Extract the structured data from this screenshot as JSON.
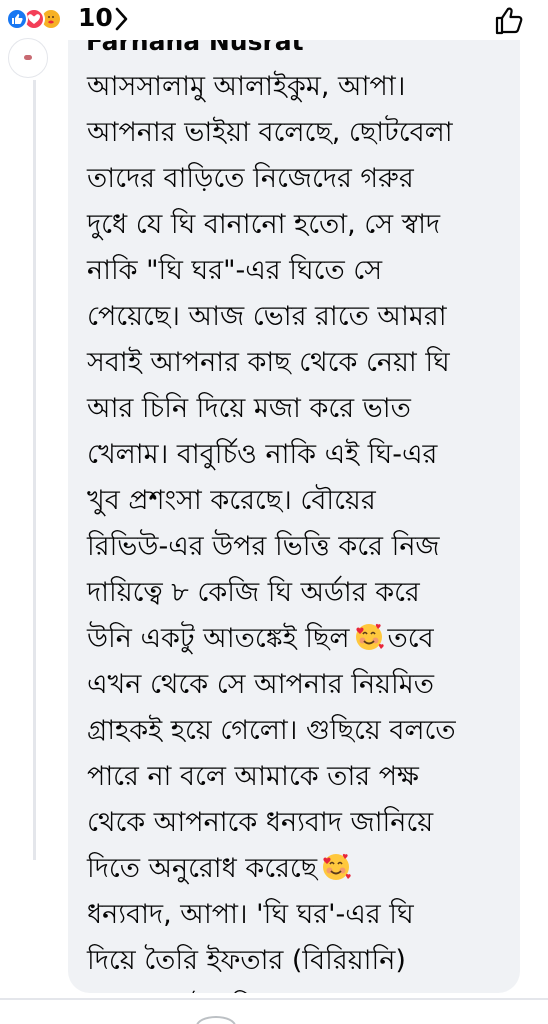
{
  "reactions": {
    "types": [
      "like-icon",
      "love-icon",
      "care-icon"
    ],
    "count": "10",
    "colors": {
      "like": "#1877f2",
      "love": "#f33e58",
      "care": "#f7b125"
    }
  },
  "comment": {
    "author_name": "Farhana Nusrat",
    "lines": [
      "আসসালামু আলাইকুম, আপা।",
      "আপনার ভাইয়া বলেছে, ছোটবেলা",
      "তাদের বাড়িতে নিজেদের গরুর",
      "দুধে যে ঘি বানানো হতো, সে স্বাদ",
      "নাকি \"ঘি ঘর\"-এর ঘিতে সে",
      "পেয়েছে। আজ ভোর রাতে আমরা",
      "সবাই আপনার কাছ থেকে নেয়া ঘি",
      "আর চিনি দিয়ে মজা করে ভাত",
      "খেলাম। বাবুর্চিও নাকি এই ঘি-এর",
      "খুব প্রশংসা করেছে। বৌয়ের",
      "রিভিউ-এর উপর ভিত্তি করে  নিজ",
      "দায়িত্বে ৮ কেজি ঘি অর্ডার করে",
      "উনি একটু আতঙ্কেই ছিল",
      "তবে",
      "এখন থেকে সে আপনার নিয়মিত",
      "গ্রাহকই হয়ে গেলো। গুছিয়ে বলতে",
      "পারে না বলে আমাকে তার পক্ষ",
      "থেকে আপনাকে ধন্যবাদ জানিয়ে",
      "দিতে অনুরোধ করেছে",
      "ধন্যবাদ, আপা। 'ঘি ঘর'-এর ঘি",
      "দিয়ে তৈরি ইফতার (বিরিয়ানি)",
      "খেয়ে সবাই খুশি হয়েছে।"
    ],
    "emoji": "smiling-face-with-hearts-emoji"
  },
  "colors": {
    "bubble": "#f0f2f5",
    "text": "#050505",
    "muted_icon": "#65676b"
  }
}
